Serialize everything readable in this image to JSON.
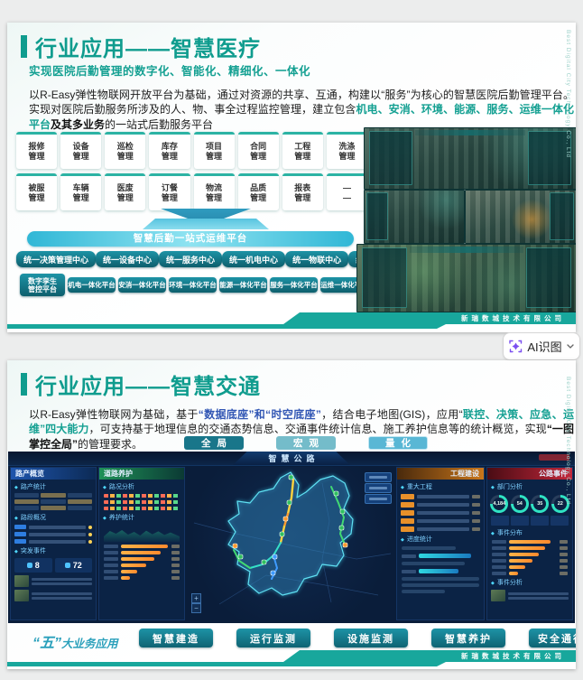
{
  "viewer": {
    "ai_button_label": "AI识图"
  },
  "company": {
    "ribbon_name": "新瑞数城技术有限公司",
    "side_text": "Best Digital City Technology Co., Ltd"
  },
  "slide1": {
    "title": "行业应用——智慧医疗",
    "subtitle": "实现医院后勤管理的数字化、智能化、精细化、一体化",
    "paragraph": [
      {
        "text": "以R-Easy弹性物联网开放平台为基础，通过对资源的共享、互通，构建以“服务”为核心的智慧医院后勤管理平台。实现对医院后勤服务所涉及的人、物、事全过程监控管理，建立包含"
      },
      {
        "text": "机电、安消、环境、能源、服务、运维一体化平台"
      },
      {
        "text": "及其多业务"
      },
      {
        "text": "的一站式后勤服务平台"
      }
    ],
    "modules": [
      {
        "top": "报修",
        "bottom": "管理"
      },
      {
        "top": "设备",
        "bottom": "管理"
      },
      {
        "top": "巡检",
        "bottom": "管理"
      },
      {
        "top": "库存",
        "bottom": "管理"
      },
      {
        "top": "项目",
        "bottom": "管理"
      },
      {
        "top": "合同",
        "bottom": "管理"
      },
      {
        "top": "工程",
        "bottom": "管理"
      },
      {
        "top": "洗涤",
        "bottom": "管理"
      },
      {
        "top": "被服",
        "bottom": "管理"
      },
      {
        "top": "车辆",
        "bottom": "管理"
      },
      {
        "top": "医废",
        "bottom": "管理"
      },
      {
        "top": "订餐",
        "bottom": "管理"
      },
      {
        "top": "物流",
        "bottom": "管理"
      },
      {
        "top": "品质",
        "bottom": "管理"
      },
      {
        "top": "报表",
        "bottom": "管理"
      },
      {
        "top": "—",
        "bottom": "—"
      }
    ],
    "banner": "智慧后勤一站式运维平台",
    "centers": [
      "统一决策管理中心",
      "统一设备中心",
      "统一服务中心",
      "统一机电中心",
      "统一物联中心",
      "统一安全中心"
    ],
    "platforms": [
      {
        "l1": "数字孪生",
        "l2": "管控平台"
      },
      {
        "l1": "机电一体化平台",
        "l2": ""
      },
      {
        "l1": "安消一体化平台",
        "l2": ""
      },
      {
        "l1": "环境一体化平台",
        "l2": ""
      },
      {
        "l1": "能源一体化平台",
        "l2": ""
      },
      {
        "l1": "服务一体化平台",
        "l2": ""
      },
      {
        "l1": "运维一体化平台",
        "l2": ""
      }
    ]
  },
  "slide2": {
    "title": "行业应用——智慧交通",
    "paragraph": [
      {
        "text": "以R-Easy弹性物联网为基础，基于"
      },
      {
        "text": "“数据底座”和“时空底座”"
      },
      {
        "text": "，结合电子地图(GIS)，应用“"
      },
      {
        "text": "联控、决策、应急、运维”四大能力"
      },
      {
        "text": "，可支持基于地理信息的交通态势信息、交通事件统计信息、施工养护信息等的统计概览，实现"
      },
      {
        "text": "“一图掌控全局”"
      },
      {
        "text": "的管理要求。"
      }
    ],
    "tabs": [
      "全局",
      "宏观",
      "量化"
    ],
    "dashboard": {
      "title": "智慧公路",
      "left_panel": {
        "title": "路产概览",
        "subs": [
          "路产统计",
          "路段概况",
          "突发事件"
        ],
        "chips": [
          "8",
          "72"
        ]
      },
      "maint_panel": {
        "title": "道路养护",
        "subs": [
          "路况分析",
          "养护统计"
        ]
      },
      "project_panel": {
        "title": "工程建设",
        "subs": [
          "重大工程",
          "进度统计"
        ]
      },
      "event_panel": {
        "title": "公路事件",
        "subs": [
          "部门分析",
          "事件分布",
          "事件分析"
        ],
        "gauges": [
          "4,184",
          "54",
          "35",
          "22"
        ]
      },
      "map_zoom": [
        "+",
        "−"
      ]
    },
    "business_label_big": "“五”",
    "business_label_rest": "大业务应用",
    "business_buttons": [
      "智慧建造",
      "运行监测",
      "设施监测",
      "智慧养护",
      "安全通行服务"
    ]
  }
}
